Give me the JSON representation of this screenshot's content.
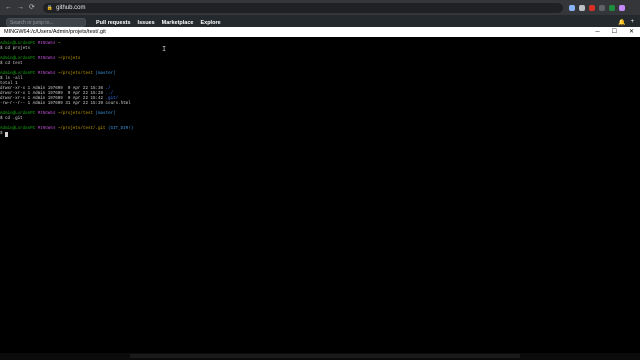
{
  "browser": {
    "url": "github.com",
    "colors": {
      "bar": "#35363a",
      "omnibox": "#202124"
    }
  },
  "github": {
    "search_placeholder": "Search or jump to...",
    "nav": [
      "Pull requests",
      "Issues",
      "Marketplace",
      "Explore"
    ]
  },
  "terminal": {
    "title": "MINGW64:/c/Users/Admin/projets/test/.git",
    "controls": {
      "minimize": "─",
      "maximize": "☐",
      "close": "✕"
    },
    "lines": [
      {
        "user": "Admin@LordanPC",
        "host": "MINGW64",
        "path": "~",
        "branch": ""
      },
      {
        "text": "$ cd projets"
      },
      {
        "gap": true
      },
      {
        "user": "Admin@LordanPC",
        "host": "MINGW64",
        "path": "~/projets",
        "branch": ""
      },
      {
        "text": "$ cd test"
      },
      {
        "gap": true
      },
      {
        "user": "Admin@LordanPC",
        "host": "MINGW64",
        "path": "~/projets/test",
        "branch": "(master)"
      },
      {
        "text": "$ ls -all"
      },
      {
        "text": "total 1"
      },
      {
        "text": "drwxr-xr-x 1 Admin 197609  0 Apr 22 15:36 ",
        "dir": "./"
      },
      {
        "text": "drwxr-xr-x 1 Admin 197609  0 Apr 22 15:28 ",
        "dir": "../"
      },
      {
        "text": "drwxr-xr-x 1 Admin 197609  0 Apr 22 15:42 ",
        "dir": ".git/"
      },
      {
        "text": "-rw-r--r-- 1 Admin 197609 31 Apr 22 15:39 cours.html"
      },
      {
        "gap": true
      },
      {
        "user": "Admin@LordanPC",
        "host": "MINGW64",
        "path": "~/projets/test",
        "branch": "(master)"
      },
      {
        "text": "$ cd .git"
      },
      {
        "gap": true
      },
      {
        "user": "Admin@LordanPC",
        "host": "MINGW64",
        "path": "~/projets/test/.git",
        "branch": "(GIT_DIR!)"
      },
      {
        "text": "$ ",
        "cursor": true
      }
    ]
  }
}
